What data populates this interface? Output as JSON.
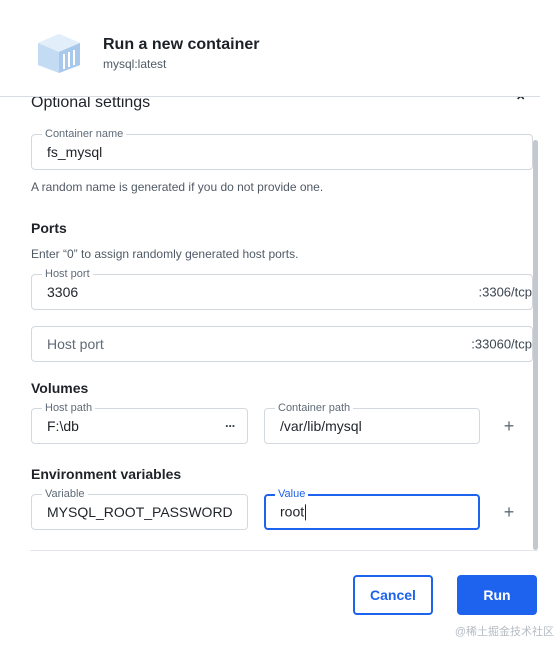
{
  "header": {
    "title": "Run a new container",
    "subtitle": "mysql:latest",
    "icon": "container-box-icon"
  },
  "optional_settings": {
    "title": "Optional settings",
    "collapse_icon": "chevron-up-icon"
  },
  "container_name": {
    "label": "Container name",
    "value": "fs_mysql",
    "helper": "A random name is generated if you do not provide one."
  },
  "ports": {
    "title": "Ports",
    "helper": "Enter “0” to assign randomly generated host ports.",
    "rows": [
      {
        "label": "Host port",
        "value": "3306",
        "placeholder": "",
        "suffix": ":3306/tcp"
      },
      {
        "label": "",
        "value": "",
        "placeholder": "Host port",
        "suffix": ":33060/tcp"
      }
    ]
  },
  "volumes": {
    "title": "Volumes",
    "host_path_label": "Host path",
    "host_path_value": "F:\\db",
    "browse_label": "···",
    "container_path_label": "Container path",
    "container_path_value": "/var/lib/mysql",
    "add_label": "+"
  },
  "env": {
    "title": "Environment variables",
    "variable_label": "Variable",
    "variable_value": "MYSQL_ROOT_PASSWORD",
    "value_label": "Value",
    "value_value": "root",
    "add_label": "+"
  },
  "actions": {
    "cancel_label": "Cancel",
    "run_label": "Run"
  },
  "watermark": "@稀土掘金技术社区",
  "colors": {
    "accent": "#1d63ed",
    "border": "#d3d8de",
    "text": "#1f2328"
  }
}
